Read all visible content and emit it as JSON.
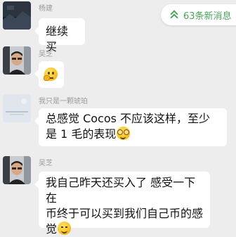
{
  "new_messages": {
    "label": "63条新消息",
    "icon": "double-chevron-up-icon",
    "color": "#4aa55a"
  },
  "messages": [
    {
      "sender": "杨建",
      "avatar": "dark-landscape-avatar",
      "text": "继续买"
    },
    {
      "sender": "吴芝",
      "avatar": "man-in-car-avatar",
      "text": "",
      "emoji": "thinking-face-emoji"
    },
    {
      "sender": "我只是一颗琥珀",
      "avatar": "pale-blue-avatar",
      "text_line1": "总感觉 Cocos 不应该这样，至少",
      "text_line2": "是 1 毛的表现",
      "emoji": "nerd-face-emoji"
    },
    {
      "sender": "吴芝",
      "avatar": "man-in-car-avatar",
      "text_line1": "我自己昨天还买入了 感受一下在",
      "text_line2": "币终于可以买到我们自己币的感",
      "text_line3": "觉",
      "emoji": "smiling-face-emoji"
    }
  ]
}
